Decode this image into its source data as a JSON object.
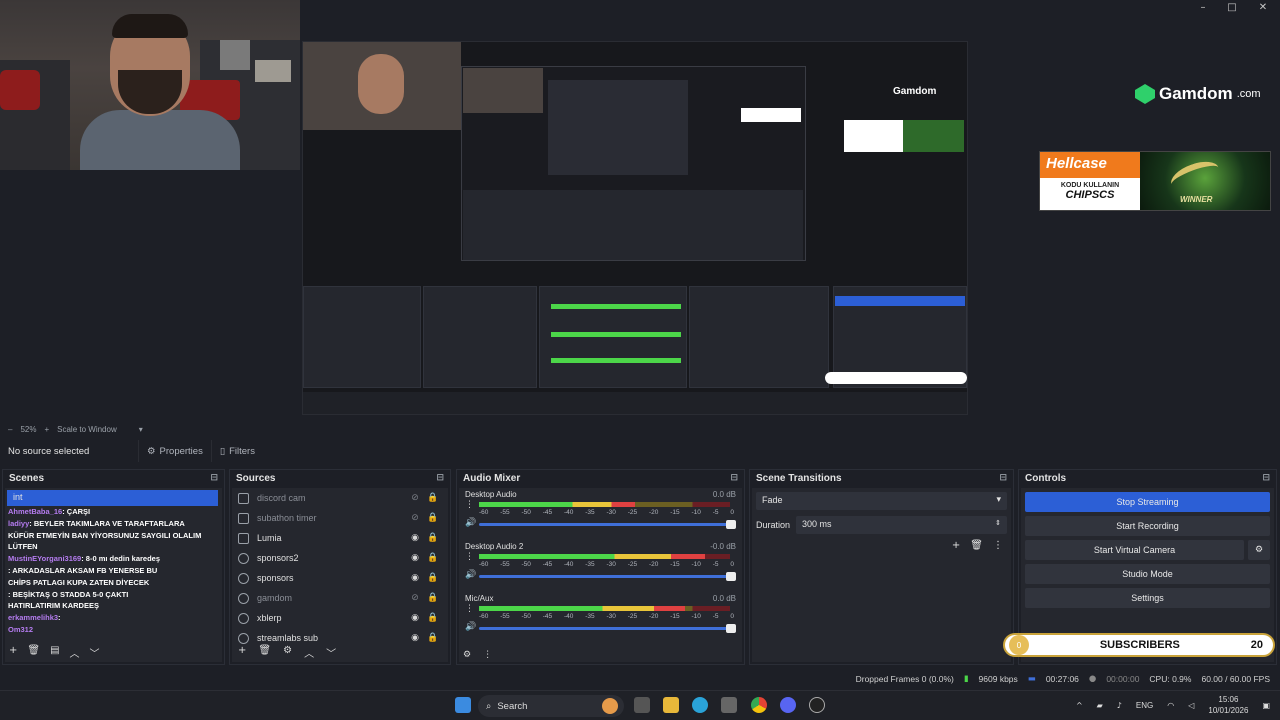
{
  "window": {
    "min": "–",
    "max": "□",
    "close": "✕"
  },
  "overlay": {
    "gamdom_brand": "Gamdom",
    "gamdom_suffix": ".com",
    "hellcase_logo": "Hellcase",
    "hellcase_sub": "KODU KULLANIN",
    "hellcase_code": "CHIPSCS",
    "hellcase_win": "WINNER"
  },
  "zoombar": {
    "minus": "–",
    "zoom": "52%",
    "plus": "+",
    "scale": "Scale to Window",
    "arrow": "▾"
  },
  "propbar": {
    "no_source": "No source selected",
    "properties": "Properties",
    "filters": "Filters"
  },
  "scenes": {
    "title": "Scenes",
    "items": [
      "int"
    ],
    "chat": [
      {
        "user": "AhmetBaba_16",
        "msg": ": ÇARŞI"
      },
      {
        "user": "ladiyy",
        "msg": ": BEYLER TAKIMLARA VE TARAFTARLARA"
      },
      {
        "user": "",
        "msg": "KÜFÜR ETMEYİN BAN YİYORSUNUZ SAYGILI OLALIM"
      },
      {
        "user": "",
        "msg": "LÜTFEN"
      },
      {
        "user": "MustinEYorgani3169",
        "msg": ": 8-0 mı dedin karedeş"
      },
      {
        "user": "",
        "msg": ""
      },
      {
        "user": "",
        "msg": ": ARKADASLAR AKSAM FB YENERSE BU"
      },
      {
        "user": "",
        "msg": "CHİPS PATLAGI KUPA ZATEN DİYECEK"
      },
      {
        "user": "",
        "msg": ": BEŞİKTAŞ O STADDA 5-0 ÇAKTI"
      },
      {
        "user": "",
        "msg": "HATIRLATIRIM KARDEEŞ"
      },
      {
        "user": "erkammelihk3",
        "msg": ":"
      },
      {
        "user": "Om312",
        "msg": ""
      }
    ]
  },
  "sources": {
    "title": "Sources",
    "items": [
      {
        "name": "discord cam",
        "dim": true
      },
      {
        "name": "subathon timer",
        "dim": true
      },
      {
        "name": "Lumia",
        "dim": false
      },
      {
        "name": "sponsors2",
        "dim": false
      },
      {
        "name": "sponsors",
        "dim": false
      },
      {
        "name": "gamdom",
        "dim": true
      },
      {
        "name": "xblerp",
        "dim": false
      },
      {
        "name": "streamlabs sub",
        "dim": false
      }
    ]
  },
  "mixer": {
    "title": "Audio Mixer",
    "ticks": [
      "-60",
      "-55",
      "-50",
      "-45",
      "-40",
      "-35",
      "-30",
      "-25",
      "-20",
      "-15",
      "-10",
      "-5",
      "0"
    ],
    "channels": [
      {
        "name": "Desktop Audio",
        "db": "0.0 dB",
        "level": 0.62
      },
      {
        "name": "Desktop Audio 2",
        "db": "-0.0 dB",
        "level": 0.9
      },
      {
        "name": "Mic/Aux",
        "db": "0.0 dB",
        "level": 0.82
      }
    ]
  },
  "transitions": {
    "title": "Scene Transitions",
    "selected": "Fade",
    "duration_label": "Duration",
    "duration_value": "300 ms"
  },
  "controls": {
    "title": "Controls",
    "stop_streaming": "Stop Streaming",
    "start_recording": "Start Recording",
    "start_virtual_camera": "Start Virtual Camera",
    "studio_mode": "Studio Mode",
    "settings": "Settings"
  },
  "subscribers": {
    "current": "0",
    "label": "SUBSCRIBERS",
    "goal": "20"
  },
  "status": {
    "dropped": "Dropped Frames 0 (0.0%)",
    "bitrate": "9609 kbps",
    "stream_time": "00:27:06",
    "rec_time": "00:00:00",
    "cpu": "CPU: 0.9%",
    "fps": "60.00 / 60.00 FPS"
  },
  "taskbar": {
    "search": "Search",
    "lang": "ENG",
    "time": "15:06",
    "date": "10/01/2026"
  },
  "colors": {
    "accent": "#2c5fd6",
    "bg": "#1d1f26",
    "panel": "#25272e"
  }
}
